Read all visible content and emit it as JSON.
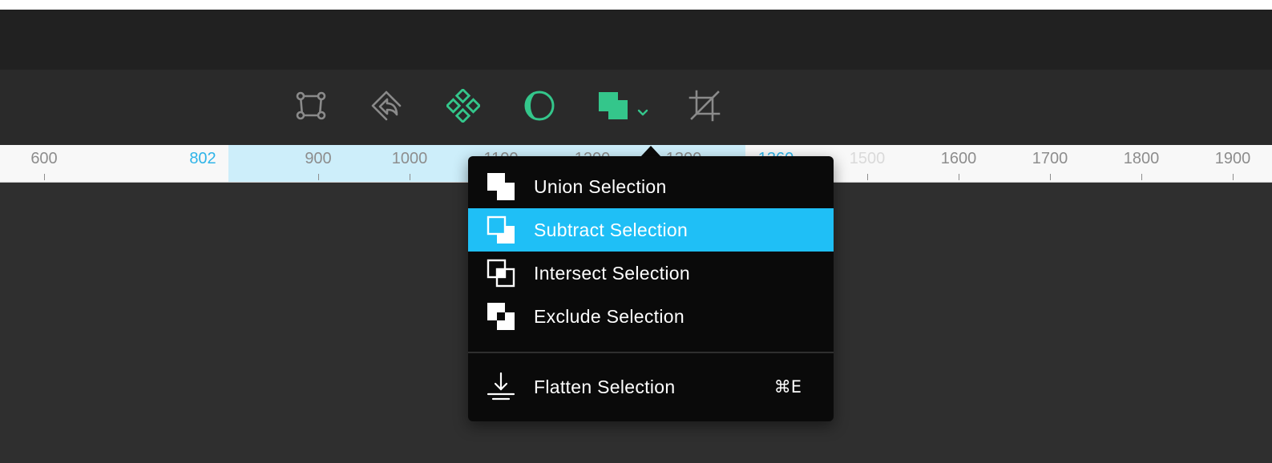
{
  "colors": {
    "accent_green": "#34c68b",
    "tool_gray": "#8a8a8a",
    "selection_blue": "#1fbff6",
    "ruler_highlight": "#cdeefa",
    "ruler_accent_text": "#2fb4e8"
  },
  "toolbar": {
    "tools": [
      {
        "icon": "frame-icon",
        "active": false
      },
      {
        "icon": "flip-icon",
        "active": false
      },
      {
        "icon": "component-icon",
        "active": true
      },
      {
        "icon": "mask-icon",
        "active": true
      },
      {
        "icon": "boolean-operation-icon",
        "active": true,
        "has_dropdown": true
      },
      {
        "icon": "crop-icon",
        "active": false
      }
    ]
  },
  "ruler": {
    "labels": [
      "600",
      "802",
      "900",
      "1000",
      "1100",
      "1200",
      "1300",
      "1360",
      "1500",
      "1600",
      "1700",
      "1800",
      "1900"
    ],
    "selection_start": "802",
    "selection_end": "1360"
  },
  "menu": {
    "items": [
      {
        "label": "Union Selection",
        "icon": "union-icon",
        "active": false
      },
      {
        "label": "Subtract Selection",
        "icon": "subtract-icon",
        "active": true
      },
      {
        "label": "Intersect Selection",
        "icon": "intersect-icon",
        "active": false
      },
      {
        "label": "Exclude Selection",
        "icon": "exclude-icon",
        "active": false
      }
    ],
    "flatten": {
      "label": "Flatten Selection",
      "icon": "flatten-icon",
      "shortcut": "⌘E"
    }
  }
}
